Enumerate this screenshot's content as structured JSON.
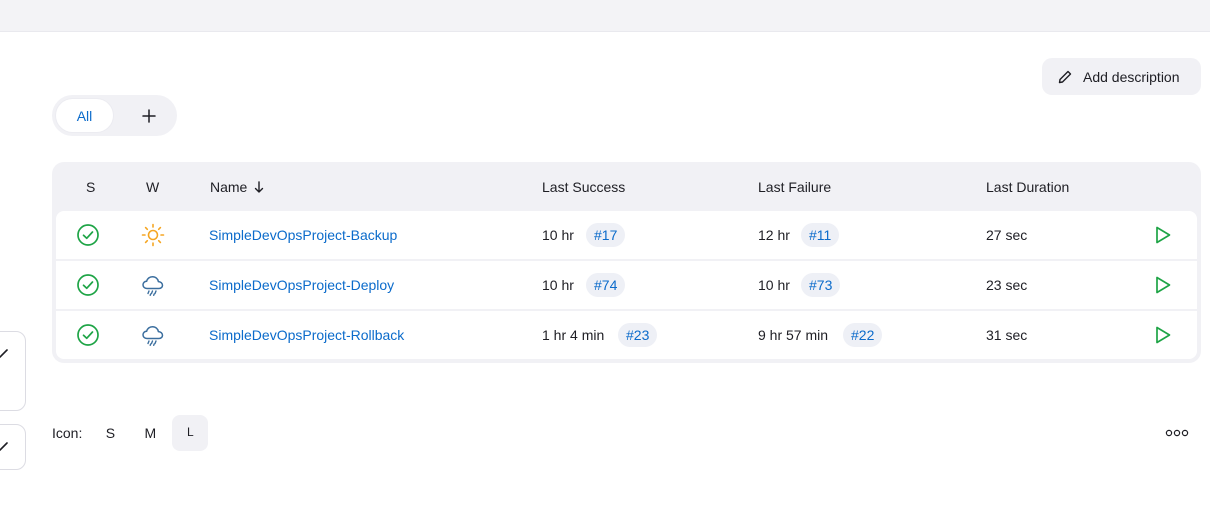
{
  "add_description": {
    "label": "Add description"
  },
  "tabs": {
    "all_label": "All",
    "add_label": "+"
  },
  "table": {
    "headers": {
      "s": "S",
      "w": "W",
      "name": "Name",
      "last_success": "Last Success",
      "last_failure": "Last Failure",
      "last_duration": "Last Duration"
    },
    "sort": {
      "column": "Name",
      "direction": "descending"
    },
    "rows": [
      {
        "status": "success",
        "weather": "sunny",
        "name": "SimpleDevOpsProject-Backup",
        "last_success_time": "10 hr",
        "last_success_build": "#17",
        "last_failure_time": "12 hr",
        "last_failure_build": "#11",
        "last_duration": "27 sec"
      },
      {
        "status": "success",
        "weather": "rain",
        "name": "SimpleDevOpsProject-Deploy",
        "last_success_time": "10 hr",
        "last_success_build": "#74",
        "last_failure_time": "10 hr",
        "last_failure_build": "#73",
        "last_duration": "23 sec"
      },
      {
        "status": "success",
        "weather": "rain",
        "name": "SimpleDevOpsProject-Rollback",
        "last_success_time": "1 hr 4 min",
        "last_success_build": "#23",
        "last_failure_time": "9 hr 57 min",
        "last_failure_build": "#22",
        "last_duration": "31 sec"
      }
    ]
  },
  "icon_size": {
    "label": "Icon:",
    "options": [
      "S",
      "M",
      "L"
    ],
    "selected": "L"
  },
  "icons": {
    "status": "check-circle-icon",
    "weather_sunny": "sun-icon",
    "weather_rain": "rain-cloud-icon",
    "build": "play-icon",
    "edit": "pencil-icon",
    "more": "more-options-icon"
  },
  "colors": {
    "accent": "#0b6bcb",
    "success": "#1ea446",
    "sun": "#f5a623",
    "cloud": "#3b6e9e"
  }
}
